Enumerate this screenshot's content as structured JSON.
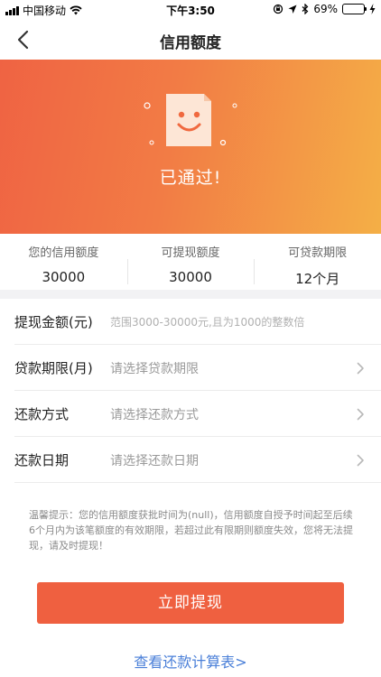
{
  "status_bar": {
    "carrier": "中国移动",
    "time": "下午3:50",
    "battery": "69%",
    "battery_level": 0.69
  },
  "nav": {
    "title": "信用额度",
    "back_icon": "chevron-left-icon"
  },
  "hero": {
    "status_text": "已通过!",
    "icon": "smiley-document-icon"
  },
  "summary": [
    {
      "label": "您的信用额度",
      "value": "30000"
    },
    {
      "label": "可提现额度",
      "value": "30000"
    },
    {
      "label": "可贷款期限",
      "value": "12个月"
    }
  ],
  "form": {
    "rows": [
      {
        "label": "提现金额(元)",
        "placeholder": "范围3000-30000元,且为1000的整数倍",
        "has_chevron": false
      },
      {
        "label": "贷款期限(月)",
        "placeholder": "请选择贷款期限",
        "has_chevron": true
      },
      {
        "label": "还款方式",
        "placeholder": "请选择还款方式",
        "has_chevron": true
      },
      {
        "label": "还款日期",
        "placeholder": "请选择还款日期",
        "has_chevron": true
      }
    ]
  },
  "tip": "温馨提示：您的信用额度获批时间为(null)，信用额度自授予时间起至后续6个月内为该笔额度的有效期限，若超过此有限期则额度失效，您将无法提现，请及时提现！",
  "actions": {
    "submit_label": "立即提现",
    "calc_link": "查看还款计算表>"
  },
  "colors": {
    "accent": "#ef6040",
    "gradient_start": "#ef6343",
    "gradient_end": "#f4af46",
    "link": "#4a7fd8"
  }
}
